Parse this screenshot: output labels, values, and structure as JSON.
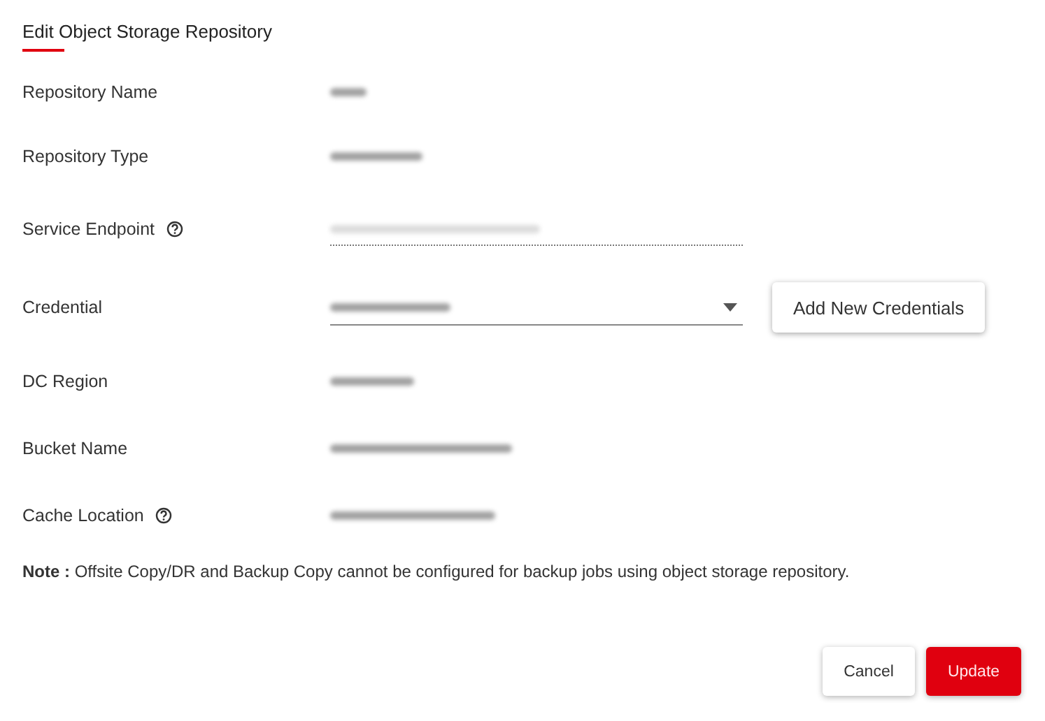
{
  "title": "Edit Object Storage Repository",
  "fields": [
    {
      "kind": "text",
      "label": "Repository Name",
      "help": false
    },
    {
      "kind": "text",
      "label": "Repository Type",
      "help": false
    },
    {
      "kind": "input",
      "label": "Service Endpoint",
      "help": true,
      "disabled": true
    },
    {
      "kind": "select",
      "label": "Credential",
      "help": false,
      "action": "Add New Credentials"
    },
    {
      "kind": "text",
      "label": "DC Region",
      "help": false
    },
    {
      "kind": "text",
      "label": "Bucket Name",
      "help": false
    },
    {
      "kind": "text",
      "label": "Cache Location",
      "help": true
    }
  ],
  "note": "**Note :** Offsite Copy/DR and Backup Copy cannot be configured for backup jobs using object storage repository.",
  "buttons": [
    {
      "label": "Cancel",
      "kind": "secondary"
    },
    {
      "label": "Update",
      "kind": "primary"
    }
  ]
}
